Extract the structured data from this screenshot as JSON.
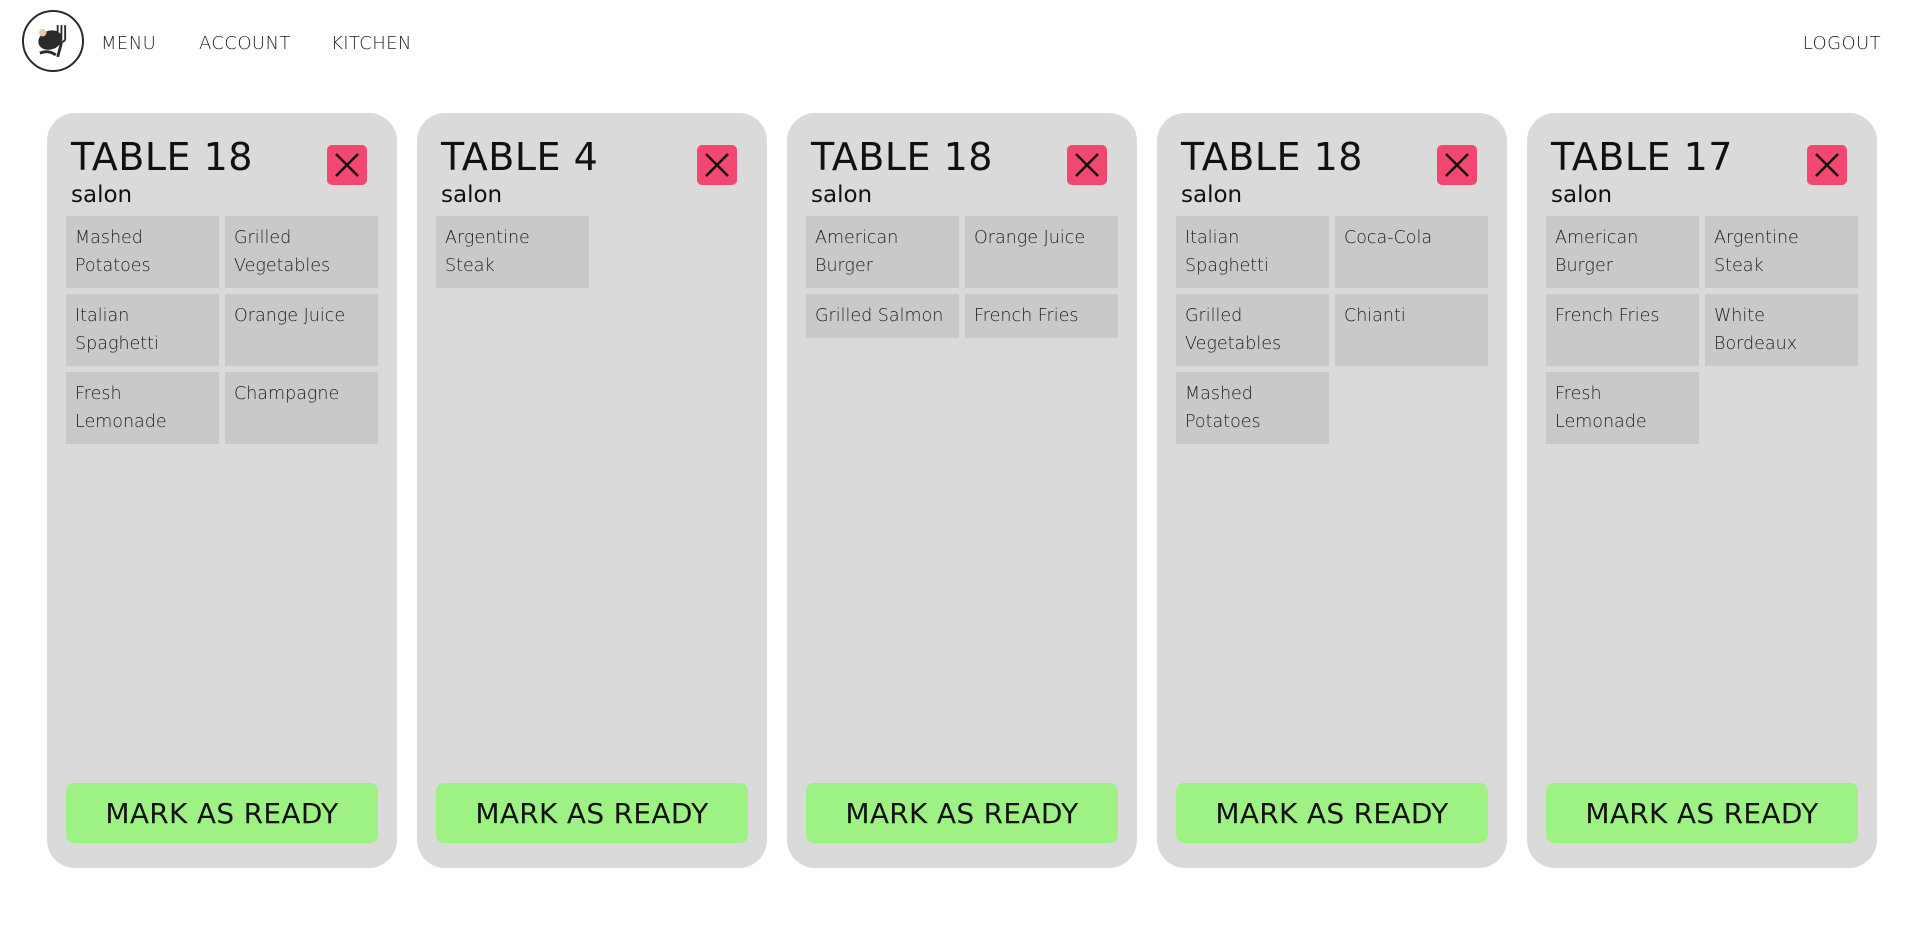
{
  "nav": {
    "menu": "MENU",
    "account": "ACCOUNT",
    "kitchen": "KITCHEN",
    "logout": "LOGOUT"
  },
  "colors": {
    "card_bg": "#dadada",
    "item_bg": "#c9c9c9",
    "close_button": "#f24770",
    "ready_button": "#9df283"
  },
  "orders": [
    {
      "table": "TABLE 18",
      "area": "salon",
      "items": [
        "Mashed Potatoes",
        "Grilled Vegetables",
        "Italian Spaghetti",
        "Orange Juice",
        "Fresh Lemonade",
        "Champagne"
      ],
      "action": "MARK AS READY"
    },
    {
      "table": "TABLE 4",
      "area": "salon",
      "items": [
        "Argentine Steak"
      ],
      "action": "MARK AS READY"
    },
    {
      "table": "TABLE 18",
      "area": "salon",
      "items": [
        "American Burger",
        "Orange Juice",
        "Grilled Salmon",
        "French Fries"
      ],
      "action": "MARK AS READY"
    },
    {
      "table": "TABLE 18",
      "area": "salon",
      "items": [
        "Italian Spaghetti",
        "Coca-Cola",
        "Grilled Vegetables",
        "Chianti",
        "Mashed Potatoes"
      ],
      "action": "MARK AS READY"
    },
    {
      "table": "TABLE 17",
      "area": "salon",
      "items": [
        "American Burger",
        "Argentine Steak",
        "French Fries",
        "White Bordeaux",
        "Fresh Lemonade"
      ],
      "action": "MARK AS READY"
    }
  ]
}
